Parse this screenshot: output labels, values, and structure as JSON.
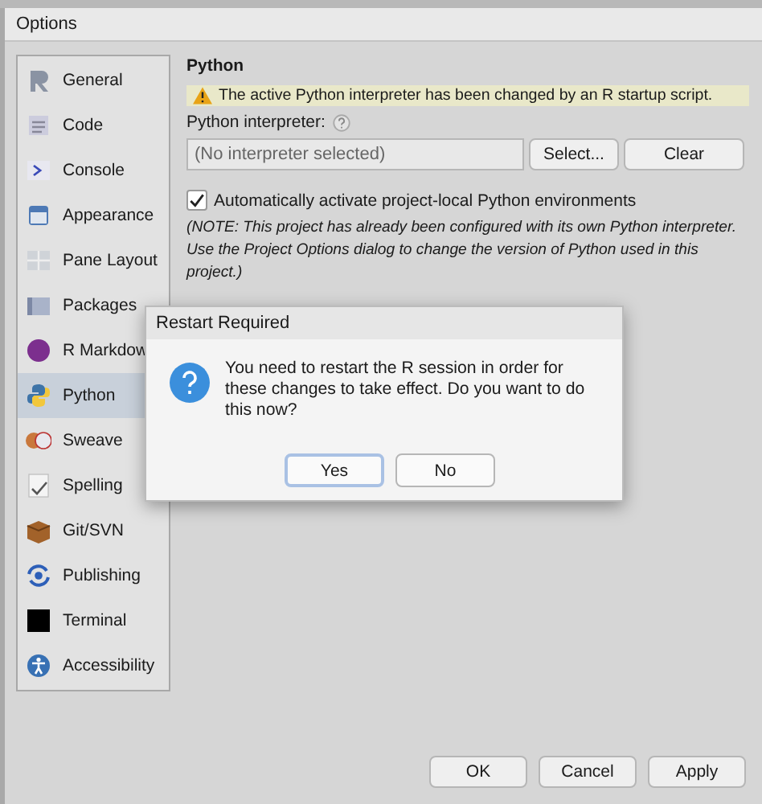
{
  "window": {
    "title": "Options"
  },
  "sidebar": {
    "items": [
      {
        "label": "General",
        "selected": false
      },
      {
        "label": "Code",
        "selected": false
      },
      {
        "label": "Console",
        "selected": false
      },
      {
        "label": "Appearance",
        "selected": false
      },
      {
        "label": "Pane Layout",
        "selected": false
      },
      {
        "label": "Packages",
        "selected": false
      },
      {
        "label": "R Markdow",
        "selected": false
      },
      {
        "label": "Python",
        "selected": true
      },
      {
        "label": "Sweave",
        "selected": false
      },
      {
        "label": "Spelling",
        "selected": false
      },
      {
        "label": "Git/SVN",
        "selected": false
      },
      {
        "label": "Publishing",
        "selected": false
      },
      {
        "label": "Terminal",
        "selected": false
      },
      {
        "label": "Accessibility",
        "selected": false
      }
    ]
  },
  "panel": {
    "heading": "Python",
    "warning": "The active Python interpreter has been changed by an R startup script.",
    "interpreter_label": "Python interpreter:",
    "interpreter_value": "(No interpreter selected)",
    "buttons": [
      "Select...",
      "Clear"
    ],
    "auto_activate": {
      "label": "Automatically activate project-local Python environments",
      "checked": true
    },
    "note": "(NOTE: This project has already been configured with its own Python interpreter. Use the Project Options dialog to change the version of Python used in this project.)"
  },
  "dialog": {
    "title": "Restart Required",
    "message": "You need to restart the R session in order for these changes to take effect. Do you want to do this now?",
    "buttons": [
      {
        "label": "Yes",
        "default": true
      },
      {
        "label": "No",
        "default": false
      }
    ]
  },
  "footer": {
    "buttons": [
      "OK",
      "Cancel",
      "Apply"
    ]
  }
}
